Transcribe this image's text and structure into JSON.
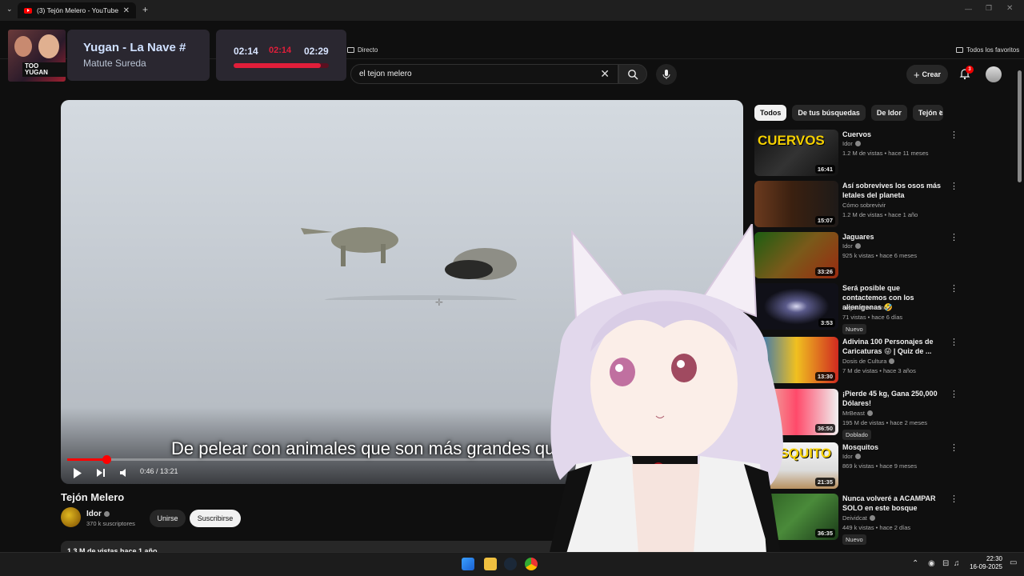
{
  "browser": {
    "tab_title": "(3) Tejón Melero - YouTube",
    "bookmarks": [
      {
        "label": "Directo"
      },
      {
        "label": "Todos los favoritos"
      }
    ]
  },
  "overlay": {
    "cam_sign": "TOO YUGAN",
    "now_playing_title": "Yugan - La Nave #",
    "now_playing_artist": "Matute Sureda",
    "time_current": "02:14",
    "time_mid": "02:14",
    "time_total": "02:29",
    "progress": 0.92
  },
  "header": {
    "search_value": "el tejon melero",
    "create_label": "Crear",
    "notification_count": "3"
  },
  "player": {
    "subtitle": "De pelear con animales que son más grandes que",
    "time": "0:46 / 13:21",
    "progress": 0.058
  },
  "video": {
    "title": "Tejón Melero",
    "channel": "Idor",
    "subscribers": "370 k suscriptores",
    "join_label": "Unirse",
    "subscribe_label": "Suscribirse",
    "views": "1.3 M de vistas  hace 1 año"
  },
  "chips": [
    "Todos",
    "De tus búsquedas",
    "De Idor",
    "Tejón c"
  ],
  "recommendations": [
    {
      "title": "Cuervos",
      "channel": "Idor",
      "verified": true,
      "meta": "1.2 M de vistas • hace 11 meses",
      "duration": "16:41",
      "caption": "CUERVOS",
      "bg": "linear-gradient(135deg,#111 0%,#333 50%,#111 100%)"
    },
    {
      "title": "Así sobrevives los osos más letales del planeta",
      "channel": "Cómo sobrevivir",
      "verified": false,
      "meta": "1.2 M de vistas • hace 1 año",
      "duration": "15:07",
      "caption": "",
      "bg": "linear-gradient(90deg,#6b3a1e 0%,#3a2010 45%,#1e1a18 100%)"
    },
    {
      "title": "Jaguares",
      "channel": "Idor",
      "verified": true,
      "meta": "925 k vistas • hace 6 meses",
      "duration": "33:26",
      "caption": "",
      "bg": "linear-gradient(135deg,#1c5e12 0%,#7a5a1a 50%,#9a2a10 100%)"
    },
    {
      "title": "Será posible que contactemos con los alienígenas 🤣",
      "channel": "Legio astronomo",
      "verified": false,
      "meta": "71 vistas • hace 6 días",
      "duration": "3:53",
      "caption": "",
      "tag": "Nuevo",
      "bg": "radial-gradient(ellipse at 50% 50%,#d8d8f0 0%,#5a5a8a 18%,#101018 55%)"
    },
    {
      "title": "Adivina 100 Personajes de Caricaturas 😜 | Quiz de ...",
      "channel": "Dosis de Cultura",
      "verified": true,
      "meta": "7 M de vistas • hace 3 años",
      "duration": "13:30",
      "caption": "",
      "bg": "linear-gradient(90deg,#1a6acc 0%,#f0c020 50%,#d02a20 100%)"
    },
    {
      "title": "¡Pierde 45 kg, Gana 250,000 Dólares!",
      "channel": "MrBeast",
      "verified": true,
      "meta": "195 M de vistas • hace 2 meses",
      "duration": "36:50",
      "caption": "",
      "tag": "Doblado",
      "bg": "linear-gradient(90deg,#e8d0b8 0%,#ff4a6a 50%,#f0f0f0 100%)"
    },
    {
      "title": "Mosquitos",
      "channel": "Idor",
      "verified": true,
      "meta": "869 k vistas • hace 9 meses",
      "duration": "21:35",
      "caption": "MOSQUITO",
      "bg": "linear-gradient(180deg,#f5f5f5 0%,#dcdcdc 60%,#b89060 100%)"
    },
    {
      "title": "Nunca volveré a ACAMPAR SOLO en este bosque",
      "channel": "Deividcat",
      "verified": true,
      "meta": "449 k vistas • hace 2 días",
      "duration": "36:35",
      "caption": "",
      "tag": "Nuevo",
      "bg": "linear-gradient(135deg,#2a5a20 0%,#4a8a3a 50%,#1a3a18 100%)"
    }
  ],
  "taskbar": {
    "time": "22:30",
    "date": "16-09-2025"
  }
}
